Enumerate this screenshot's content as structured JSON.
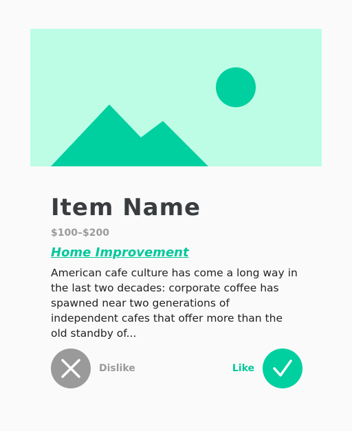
{
  "hero": {
    "image_icon": "image-placeholder-icon",
    "background_color": "#bdfde5",
    "accent_color": "#00cf9f"
  },
  "item": {
    "name": "Item Name",
    "price_range": "$100–$200",
    "category": "Home Improvement",
    "description": "American cafe culture has come a long way in the last two decades: corporate coffee has spawned near two generations of independent cafes that offer more than the old standby of..."
  },
  "actions": {
    "dislike": {
      "label": "Dislike",
      "icon": "close-icon",
      "color": "#9a9a9a"
    },
    "like": {
      "label": "Like",
      "icon": "checkmark-icon",
      "color": "#00cf9f"
    }
  }
}
